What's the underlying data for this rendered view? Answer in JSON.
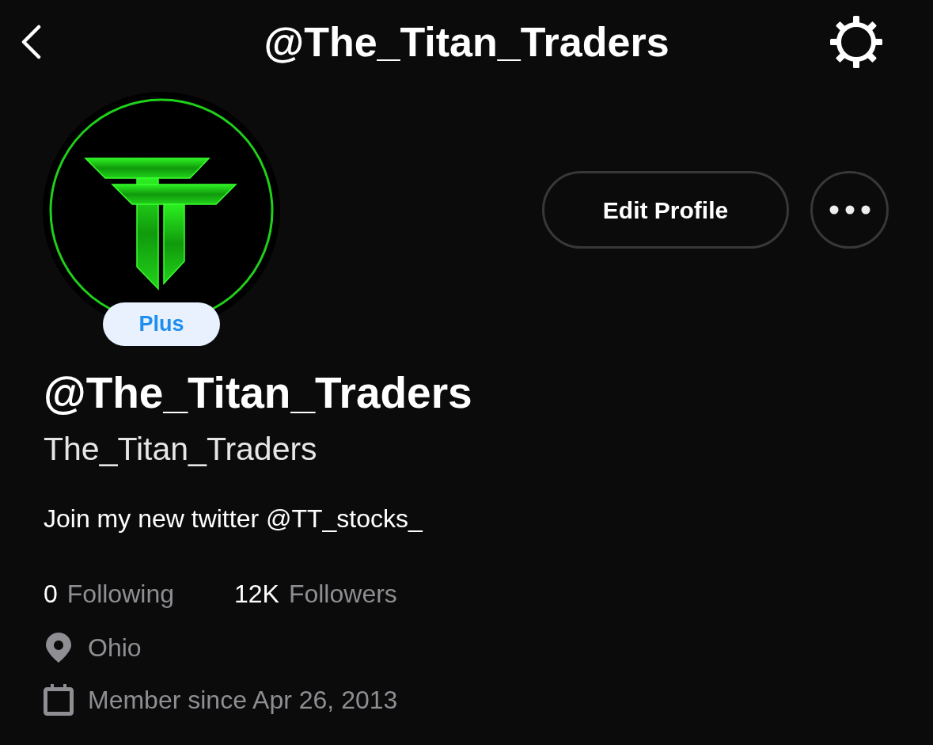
{
  "header": {
    "title": "@The_Titan_Traders"
  },
  "profile": {
    "badge": "Plus",
    "edit_button": "Edit Profile",
    "handle": "@The_Titan_Traders",
    "display_name": "The_Titan_Traders",
    "bio": "Join my new twitter @TT_stocks_"
  },
  "stats": [
    {
      "count": "0",
      "label": "Following"
    },
    {
      "count": "12K",
      "label": "Followers"
    }
  ],
  "details": [
    {
      "kind": "location",
      "text": "Ohio"
    },
    {
      "kind": "date",
      "text": "Member since Apr 26, 2013"
    }
  ]
}
